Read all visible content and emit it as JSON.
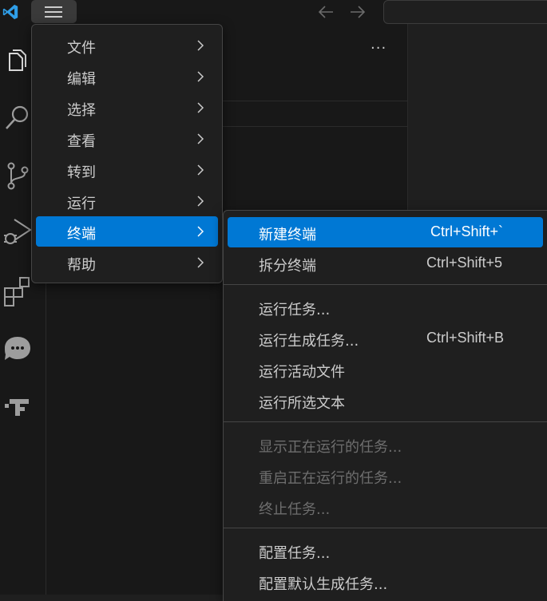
{
  "colors": {
    "accent": "#0078d4",
    "menu_bg": "#1f1f1f",
    "menu_border": "#454545",
    "text": "#cccccc",
    "text_disabled": "#6e6e6e",
    "logo": "#2f9ee8"
  },
  "titlebar": {
    "logo_icon": "vscode-logo-icon",
    "menu_icon": "hamburger-menu-icon",
    "back_icon": "arrow-left-icon",
    "forward_icon": "arrow-right-icon"
  },
  "activity_bar": {
    "items": [
      {
        "icon": "explorer-files-icon"
      },
      {
        "icon": "search-icon"
      },
      {
        "icon": "source-control-icon"
      },
      {
        "icon": "run-and-debug-icon"
      },
      {
        "icon": "extensions-icon"
      },
      {
        "icon": "chat-icon"
      },
      {
        "icon": "remote-icon"
      }
    ]
  },
  "sidebar": {
    "more_actions": "···"
  },
  "main_menu": {
    "items": [
      {
        "label": "文件"
      },
      {
        "label": "编辑"
      },
      {
        "label": "选择"
      },
      {
        "label": "查看"
      },
      {
        "label": "转到"
      },
      {
        "label": "运行"
      },
      {
        "label": "终端",
        "active": true
      },
      {
        "label": "帮助"
      }
    ]
  },
  "terminal_submenu": {
    "groups": [
      [
        {
          "label": "新建终端",
          "shortcut": "Ctrl+Shift+`",
          "active": true
        },
        {
          "label": "拆分终端",
          "shortcut": "Ctrl+Shift+5"
        }
      ],
      [
        {
          "label": "运行任务..."
        },
        {
          "label": "运行生成任务...",
          "shortcut": "Ctrl+Shift+B"
        },
        {
          "label": "运行活动文件"
        },
        {
          "label": "运行所选文本"
        }
      ],
      [
        {
          "label": "显示正在运行的任务...",
          "disabled": true
        },
        {
          "label": "重启正在运行的任务...",
          "disabled": true
        },
        {
          "label": "终止任务...",
          "disabled": true
        }
      ],
      [
        {
          "label": "配置任务..."
        },
        {
          "label": "配置默认生成任务..."
        }
      ]
    ]
  }
}
